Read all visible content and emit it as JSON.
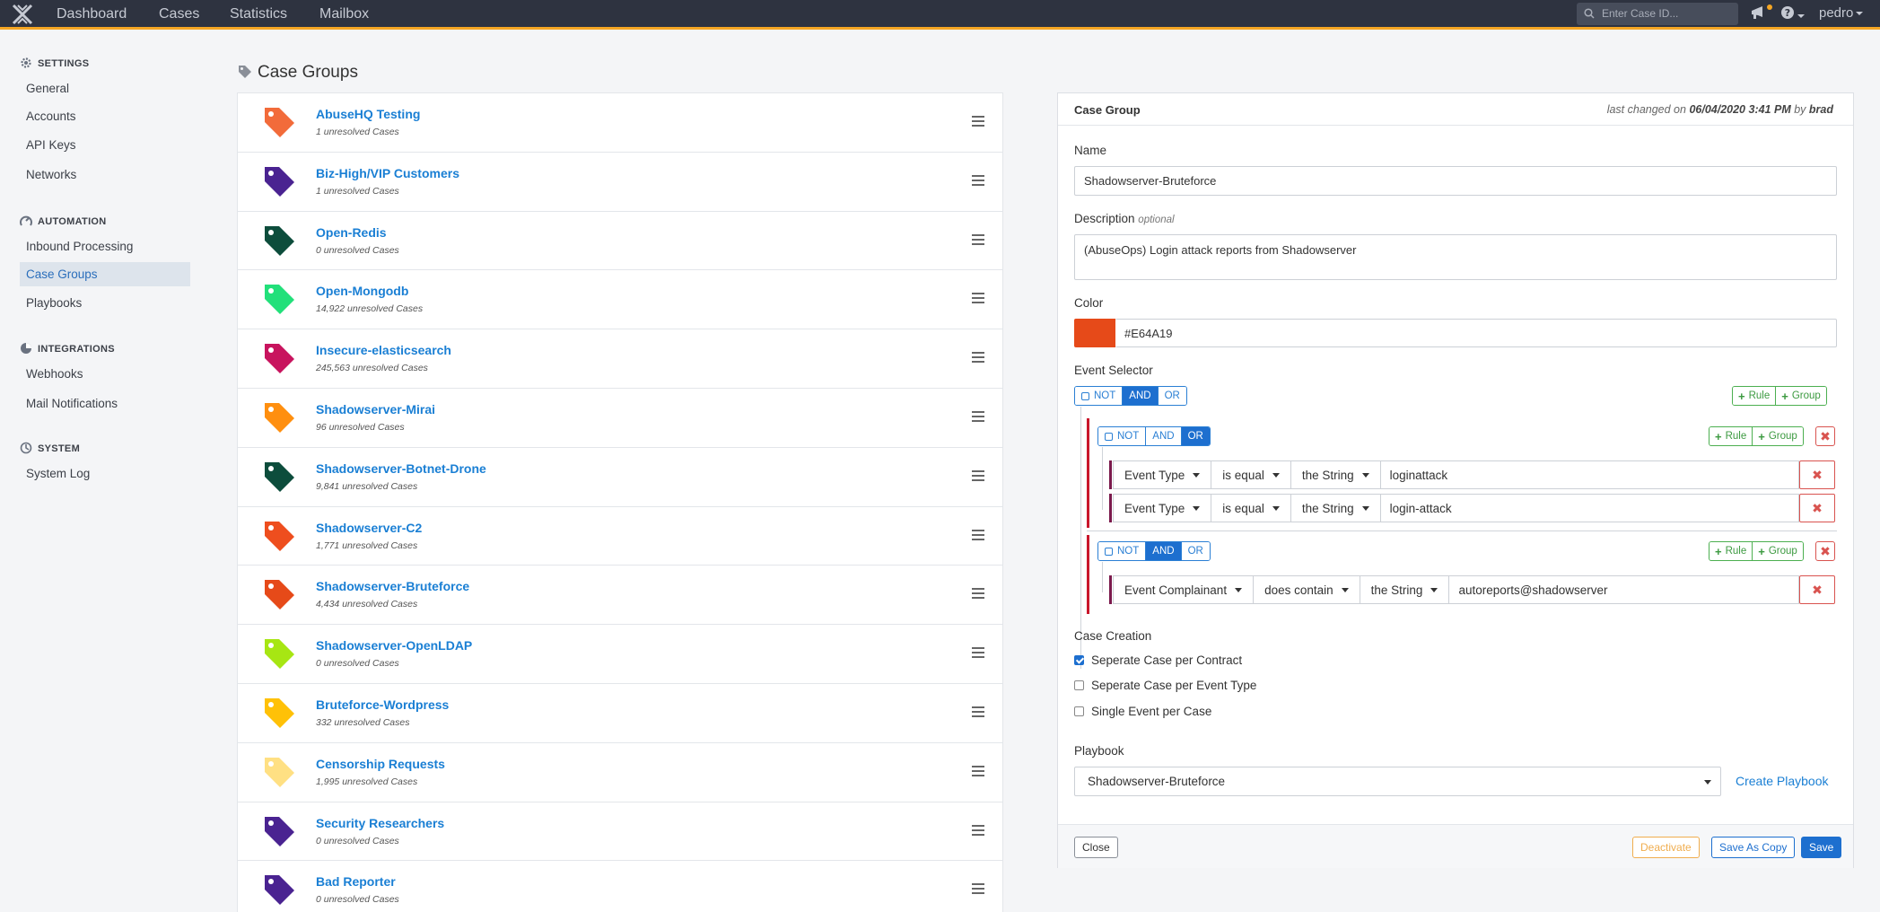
{
  "nav": {
    "items": [
      "Dashboard",
      "Cases",
      "Statistics",
      "Mailbox"
    ],
    "search_placeholder": "Enter Case ID...",
    "user": "pedro"
  },
  "sidebar": {
    "sections": [
      {
        "title": "SETTINGS",
        "icon": "gear-icon",
        "items": [
          "General",
          "Accounts",
          "API Keys",
          "Networks"
        ]
      },
      {
        "title": "AUTOMATION",
        "icon": "automation-icon",
        "items": [
          "Inbound Processing",
          "Case Groups",
          "Playbooks"
        ]
      },
      {
        "title": "INTEGRATIONS",
        "icon": "integrations-icon",
        "items": [
          "Webhooks",
          "Mail Notifications"
        ]
      },
      {
        "title": "SYSTEM",
        "icon": "system-icon",
        "items": [
          "System Log"
        ]
      }
    ],
    "active": "Case Groups"
  },
  "page": {
    "title": "Case Groups"
  },
  "groups": [
    {
      "name": "AbuseHQ Testing",
      "count": "1 unresolved Cases",
      "color": "#F26B3A"
    },
    {
      "name": "Biz-High/VIP Customers",
      "count": "1 unresolved Cases",
      "color": "#4A2391"
    },
    {
      "name": "Open-Redis",
      "count": "0 unresolved Cases",
      "color": "#0D4D3C"
    },
    {
      "name": "Open-Mongodb",
      "count": "14,922 unresolved Cases",
      "color": "#22E07A"
    },
    {
      "name": "Insecure-elasticsearch",
      "count": "245,563 unresolved Cases",
      "color": "#C8145E"
    },
    {
      "name": "Shadowserver-Mirai",
      "count": "96 unresolved Cases",
      "color": "#FF8F0F"
    },
    {
      "name": "Shadowserver-Botnet-Drone",
      "count": "9,841 unresolved Cases",
      "color": "#0D4D3C"
    },
    {
      "name": "Shadowserver-C2",
      "count": "1,771 unresolved Cases",
      "color": "#EE4E1E"
    },
    {
      "name": "Shadowserver-Bruteforce",
      "count": "4,434 unresolved Cases",
      "color": "#E64A19"
    },
    {
      "name": "Shadowserver-OpenLDAP",
      "count": "0 unresolved Cases",
      "color": "#A7E613"
    },
    {
      "name": "Bruteforce-Wordpress",
      "count": "332 unresolved Cases",
      "color": "#FFC107"
    },
    {
      "name": "Censorship Requests",
      "count": "1,995 unresolved Cases",
      "color": "#FFE083"
    },
    {
      "name": "Security Researchers",
      "count": "0 unresolved Cases",
      "color": "#4A2391"
    },
    {
      "name": "Bad Reporter",
      "count": "0 unresolved Cases",
      "color": "#4A2391"
    }
  ],
  "panel": {
    "title": "Case Group",
    "meta_prefix": "last changed on",
    "meta_date": "06/04/2020 3:41 PM",
    "meta_by": "by",
    "meta_user": "brad",
    "name_label": "Name",
    "name_value": "Shadowserver-Bruteforce",
    "description_label": "Description",
    "description_optional": "optional",
    "description_value": "(AbuseOps) Login attack reports from Shadowserver",
    "color_label": "Color",
    "color_value": "#E64A19",
    "selector_label": "Event Selector",
    "logic": {
      "not": "NOT",
      "and": "AND",
      "or": "OR"
    },
    "rule_btn": "Rule",
    "group_btn": "Group",
    "group1_rules": [
      {
        "field": "Event Type",
        "op": "is equal",
        "type": "the String",
        "value": "loginattack"
      },
      {
        "field": "Event Type",
        "op": "is equal",
        "type": "the String",
        "value": "login-attack"
      }
    ],
    "group2_rules": [
      {
        "field": "Event Complainant",
        "op": "does contain",
        "type": "the String",
        "value": "autoreports@shadowserver"
      }
    ],
    "case_creation_label": "Case Creation",
    "options": [
      {
        "label": "Seperate Case per Contract",
        "checked": true
      },
      {
        "label": "Seperate Case per Event Type",
        "checked": false
      },
      {
        "label": "Single Event per Case",
        "checked": false
      }
    ],
    "playbook_label": "Playbook",
    "playbook_value": "Shadowserver-Bruteforce",
    "create_playbook": "Create Playbook",
    "buttons": {
      "close": "Close",
      "deactivate": "Deactivate",
      "save_copy": "Save As Copy",
      "save": "Save"
    }
  }
}
